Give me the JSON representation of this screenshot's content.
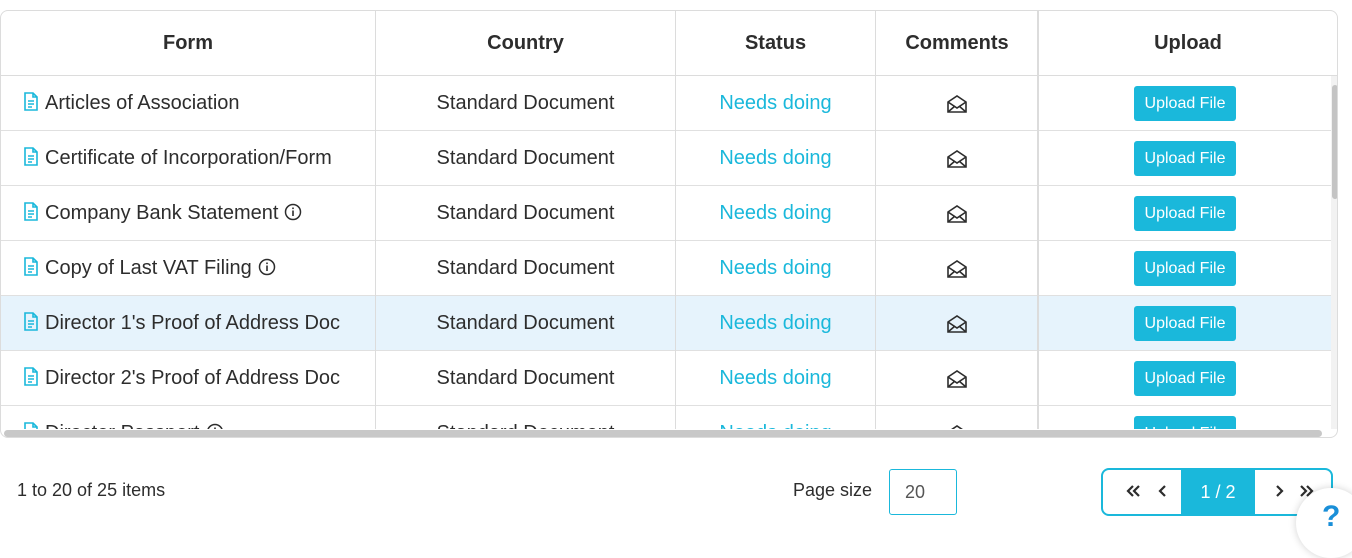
{
  "grid": {
    "columns": {
      "form": "Form",
      "country": "Country",
      "status": "Status",
      "comments": "Comments",
      "upload": "Upload"
    },
    "rows": [
      {
        "form": "Articles of Association",
        "info": false,
        "country": "Standard Document",
        "status": "Needs doing",
        "upload": "Upload File",
        "selected": false
      },
      {
        "form": "Certificate of Incorporation/Form",
        "info": false,
        "country": "Standard Document",
        "status": "Needs doing",
        "upload": "Upload File",
        "selected": false
      },
      {
        "form": "Company Bank Statement",
        "info": true,
        "country": "Standard Document",
        "status": "Needs doing",
        "upload": "Upload File",
        "selected": false
      },
      {
        "form": "Copy of Last VAT Filing",
        "info": true,
        "country": "Standard Document",
        "status": "Needs doing",
        "upload": "Upload File",
        "selected": false
      },
      {
        "form": "Director 1's Proof of Address Doc",
        "info": false,
        "country": "Standard Document",
        "status": "Needs doing",
        "upload": "Upload File",
        "selected": true
      },
      {
        "form": "Director 2's Proof of Address Doc",
        "info": false,
        "country": "Standard Document",
        "status": "Needs doing",
        "upload": "Upload File",
        "selected": false
      },
      {
        "form": "Director Passport",
        "info": true,
        "country": "Standard Document",
        "status": "Needs doing",
        "upload": "Upload File",
        "selected": false
      }
    ]
  },
  "footer": {
    "items_count": "1 to 20 of 25 items",
    "page_size_label": "Page size",
    "page_size_value": "20",
    "pager": {
      "first": "«",
      "prev": "‹",
      "current": "1 / 2",
      "next": "›",
      "last": "»"
    }
  },
  "help": {
    "label": "?"
  },
  "colors": {
    "accent": "#1ab8db",
    "selected_row": "#e6f3fc",
    "help": "#1a8fd8"
  },
  "icons": {
    "form_row": "document-icon",
    "info": "info-icon",
    "comments": "envelope-icon"
  }
}
